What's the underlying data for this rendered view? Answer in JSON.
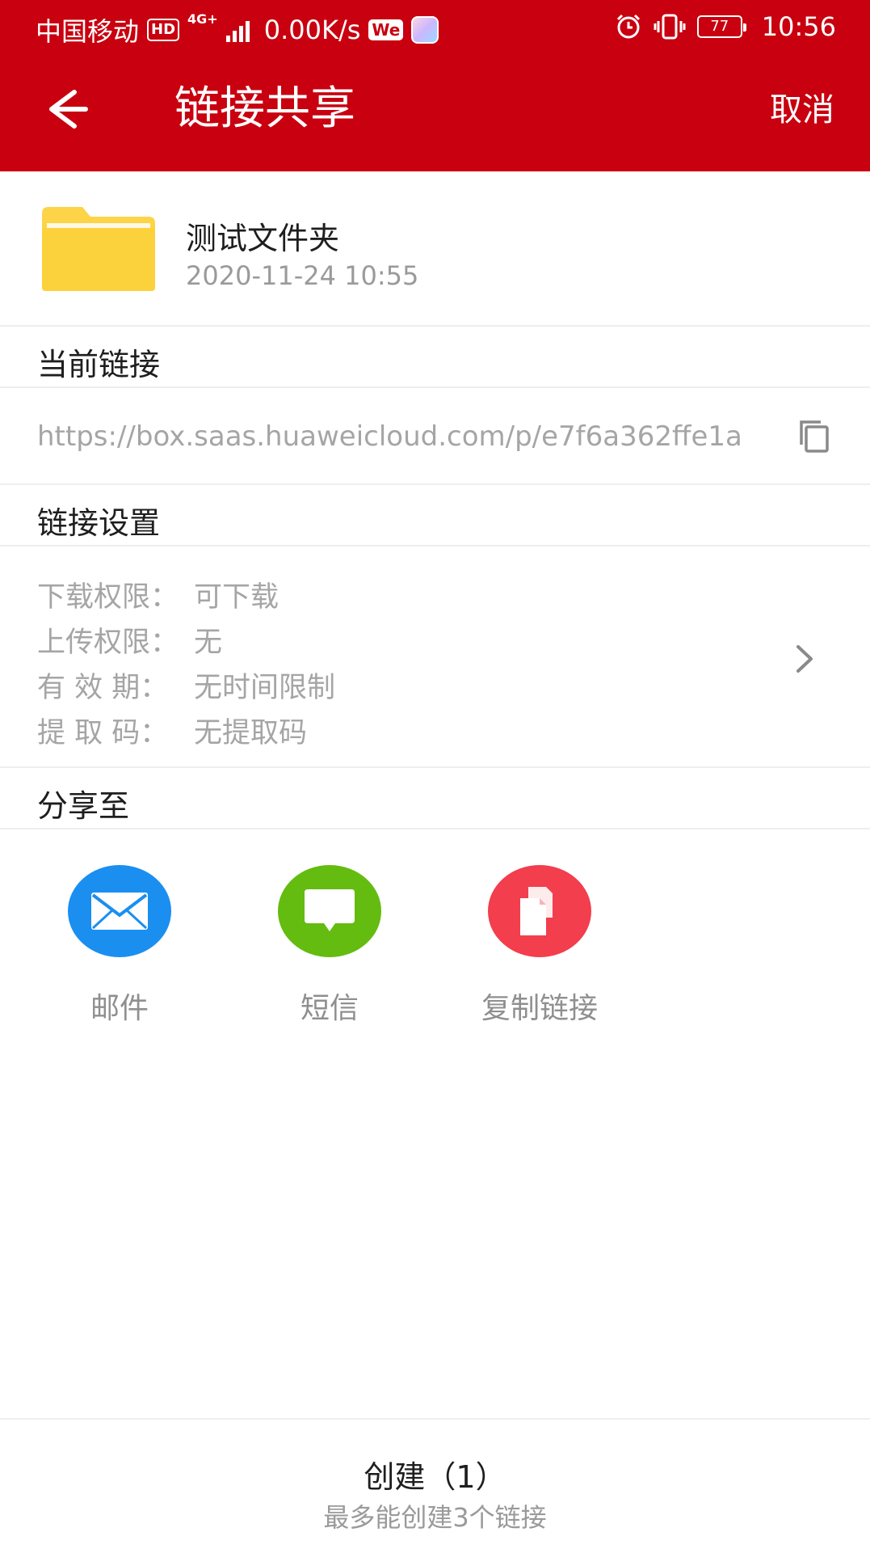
{
  "status_bar": {
    "carrier": "中国移动",
    "hd": "HD",
    "net_type": "4G+",
    "speed": "0.00K/s",
    "we_badge": "We",
    "battery": "77",
    "time": "10:56",
    "icons": [
      "alarm-icon",
      "vibrate-icon",
      "battery-icon"
    ]
  },
  "app_bar": {
    "title": "链接共享",
    "cancel": "取消",
    "back_icon": "arrow-left-icon"
  },
  "file": {
    "name": "测试文件夹",
    "date": "2020-11-24 10:55",
    "icon": "folder-icon",
    "icon_color": "#fdd447"
  },
  "current_link": {
    "header": "当前链接",
    "url": "https://box.saas.huaweicloud.com/p/e7f6a362ffe1a",
    "copy_icon": "copy-icon"
  },
  "link_settings": {
    "header": "链接设置",
    "items": [
      {
        "key": "下载权限：",
        "value": "可下载"
      },
      {
        "key": "上传权限：",
        "value": "无"
      },
      {
        "key": "有 效 期：",
        "value": "无时间限制"
      },
      {
        "key": "提 取 码：",
        "value": "无提取码"
      }
    ]
  },
  "share_to": {
    "header": "分享至",
    "targets": [
      {
        "label": "邮件",
        "icon": "mail-icon",
        "color": "#1a8ff0"
      },
      {
        "label": "短信",
        "icon": "sms-icon",
        "color": "#63bc0f"
      },
      {
        "label": "复制链接",
        "icon": "copy-link-icon",
        "color": "#f23e4d"
      }
    ]
  },
  "bottom": {
    "create": "创建（1）",
    "limit": "最多能创建3个链接"
  },
  "colors": {
    "brand": "#c8000f",
    "divider": "#eeeeee",
    "muted_text": "#a5a5a5"
  }
}
